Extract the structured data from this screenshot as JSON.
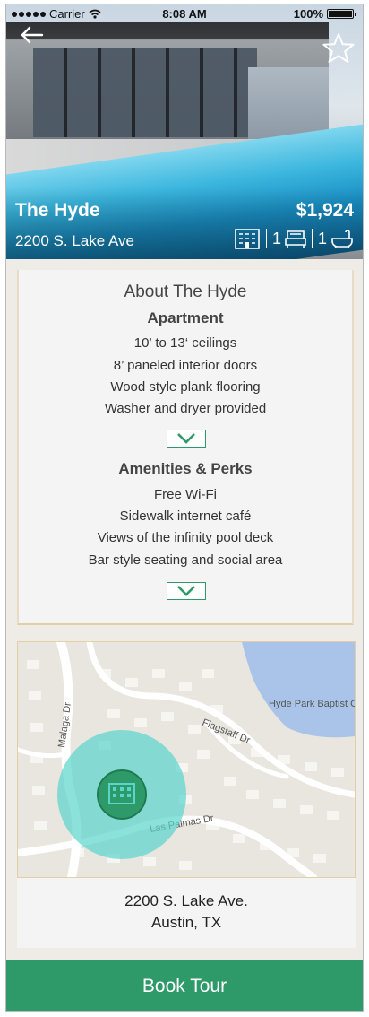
{
  "status_bar": {
    "carrier": "Carrier",
    "time": "8:08 AM",
    "battery": "100%"
  },
  "listing": {
    "name": "The Hyde",
    "address": "2200 S. Lake Ave",
    "price": "$1,924",
    "beds": "1",
    "baths": "1"
  },
  "about": {
    "title": "About The Hyde",
    "apartment_heading": "Apartment",
    "apartment_items": [
      "10’ to 13‘ ceilings",
      "8’ paneled interior doors",
      "Wood style plank flooring",
      "Washer and dryer provided"
    ],
    "amenities_heading": "Amenities & Perks",
    "amenities_items": [
      "Free Wi-Fi",
      "Sidewalk internet café",
      "Views of the infinity pool deck",
      "Bar style seating and social area"
    ]
  },
  "map": {
    "labels": {
      "church": "Hyde Park Baptist C",
      "malaga": "Malaga Dr",
      "flagstaff": "Flagstaff Dr",
      "las_palmas": "Las Palmas Dr"
    },
    "address_line1": "2200 S. Lake Ave.",
    "address_line2": "Austin, TX"
  },
  "actions": {
    "book_tour": "Book Tour"
  },
  "colors": {
    "accent": "#2e9a6a",
    "map_circle": "#59d6cc"
  }
}
